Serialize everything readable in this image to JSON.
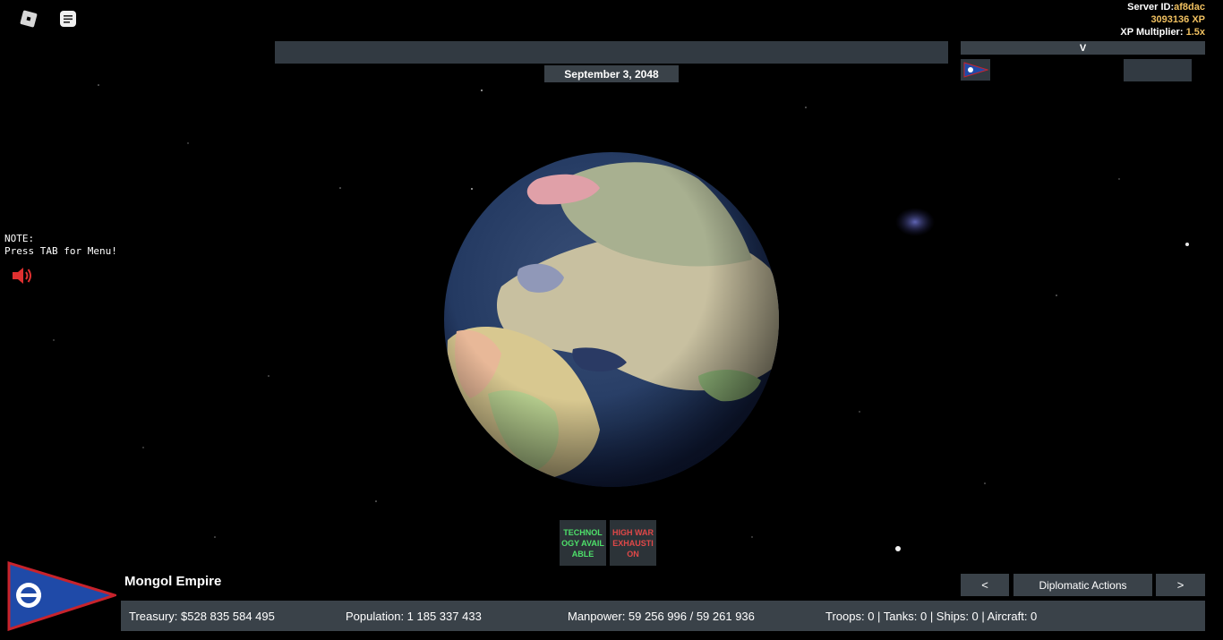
{
  "topbar": {
    "roblox_icon": "roblox-logo-icon",
    "chat_icon": "chat-icon"
  },
  "server": {
    "id_label": "Server ID:",
    "id_value": "af8dac",
    "xp": "3093136 XP",
    "multiplier_label": "XP Multiplier:",
    "multiplier_value": "1.5x"
  },
  "date": "September 3, 2048",
  "side_panel": {
    "header": "V",
    "flag_icon": "mongol-empire-flag-icon"
  },
  "note": {
    "line1": "NOTE:",
    "line2": "Press TAB for Menu!"
  },
  "speaker_icon": "speaker-icon",
  "alerts": {
    "technology": "TECHNOLOGY AVAILABLE",
    "war": "HIGH WAR EXHAUSTION"
  },
  "country": {
    "name": "Mongol Empire",
    "flag_icon": "pennant-flag-icon"
  },
  "diplomacy": {
    "prev": "<",
    "label": "Diplomatic Actions",
    "next": ">"
  },
  "stats": {
    "treasury": "Treasury:   $528 835 584 495",
    "population": "Population: 1 185 337 433",
    "manpower": "Manpower:  59 256 996  /  59 261 936",
    "military": "Troops: 0  |  Tanks: 0  |  Ships: 0  |  Aircraft: 0"
  },
  "colors": {
    "panel": "#3a4249",
    "xp_gold": "#f0c060",
    "tech_green": "#4ee06a",
    "war_red": "#e04848",
    "flag_blue": "#1f4aa8",
    "flag_red": "#c8232c"
  }
}
